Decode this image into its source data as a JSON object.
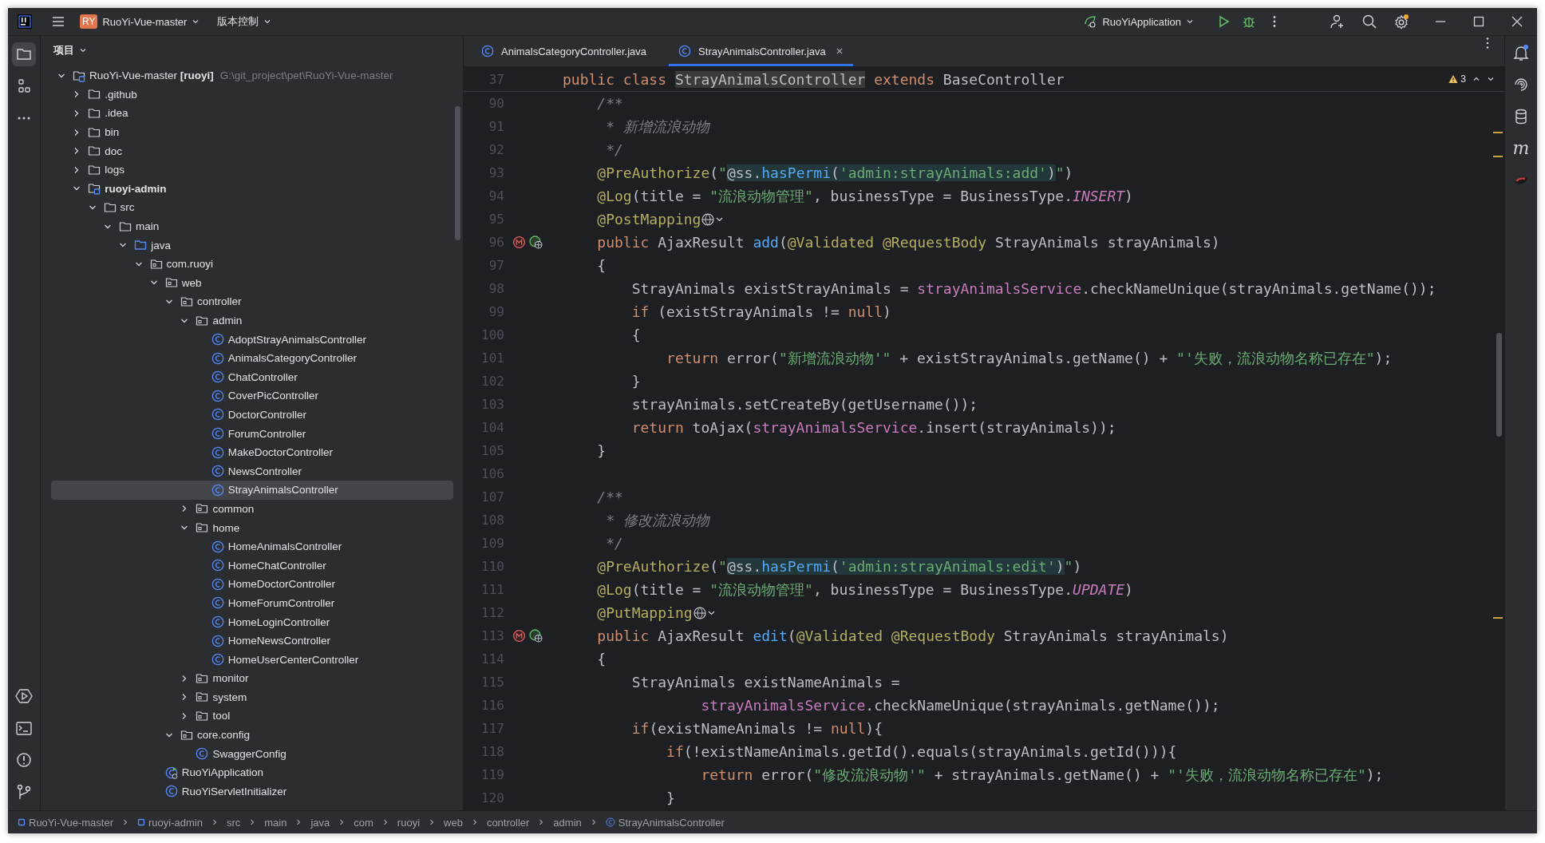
{
  "titlebar": {
    "project_badge": "RY",
    "project": "RuoYi-Vue-master",
    "vcs": "版本控制",
    "run_config": "RuoYiApplication"
  },
  "project": {
    "title": "项目",
    "tree": [
      {
        "label": "RuoYi-Vue-master **[ruoyi]**",
        "hint": "G:\\git_project\\pet\\RuoYi-Vue-master",
        "kind": "module",
        "expanded": true,
        "selected": false,
        "children": [
          {
            "label": ".github",
            "kind": "folder",
            "expanded": false,
            "selected": false
          },
          {
            "label": ".idea",
            "kind": "folder",
            "expanded": false,
            "selected": false
          },
          {
            "label": "bin",
            "kind": "folder",
            "expanded": false,
            "selected": false
          },
          {
            "label": "doc",
            "kind": "folder",
            "expanded": false,
            "selected": false
          },
          {
            "label": "logs",
            "kind": "folder",
            "expanded": false,
            "selected": false
          },
          {
            "label": "ruoyi-admin",
            "kind": "module",
            "bold": true,
            "expanded": true,
            "selected": false,
            "children": [
              {
                "label": "src",
                "kind": "folder",
                "expanded": true,
                "selected": false,
                "children": [
                  {
                    "label": "main",
                    "kind": "folder",
                    "expanded": true,
                    "selected": false,
                    "children": [
                      {
                        "label": "java",
                        "kind": "source",
                        "expanded": true,
                        "selected": false,
                        "children": [
                          {
                            "label": "com.ruoyi",
                            "kind": "package",
                            "expanded": true,
                            "selected": false,
                            "children": [
                              {
                                "label": "web",
                                "kind": "package",
                                "expanded": true,
                                "selected": false,
                                "children": [
                                  {
                                    "label": "controller",
                                    "kind": "package",
                                    "expanded": true,
                                    "selected": false,
                                    "children": [
                                      {
                                        "label": "admin",
                                        "kind": "package",
                                        "expanded": true,
                                        "selected": false,
                                        "children": [
                                          {
                                            "label": "AdoptStrayAnimalsController",
                                            "kind": "class",
                                            "selected": false
                                          },
                                          {
                                            "label": "AnimalsCategoryController",
                                            "kind": "class",
                                            "selected": false
                                          },
                                          {
                                            "label": "ChatController",
                                            "kind": "class",
                                            "selected": false
                                          },
                                          {
                                            "label": "CoverPicController",
                                            "kind": "class",
                                            "selected": false
                                          },
                                          {
                                            "label": "DoctorController",
                                            "kind": "class",
                                            "selected": false
                                          },
                                          {
                                            "label": "ForumController",
                                            "kind": "class",
                                            "selected": false
                                          },
                                          {
                                            "label": "MakeDoctorController",
                                            "kind": "class",
                                            "selected": false
                                          },
                                          {
                                            "label": "NewsController",
                                            "kind": "class",
                                            "selected": false
                                          },
                                          {
                                            "label": "StrayAnimalsController",
                                            "kind": "class",
                                            "selected": true
                                          }
                                        ]
                                      },
                                      {
                                        "label": "common",
                                        "kind": "package",
                                        "expanded": false,
                                        "selected": false
                                      },
                                      {
                                        "label": "home",
                                        "kind": "package",
                                        "expanded": true,
                                        "selected": false,
                                        "children": [
                                          {
                                            "label": "HomeAnimalsController",
                                            "kind": "class",
                                            "selected": false
                                          },
                                          {
                                            "label": "HomeChatController",
                                            "kind": "class",
                                            "selected": false
                                          },
                                          {
                                            "label": "HomeDoctorController",
                                            "kind": "class",
                                            "selected": false
                                          },
                                          {
                                            "label": "HomeForumController",
                                            "kind": "class",
                                            "selected": false
                                          },
                                          {
                                            "label": "HomeLoginController",
                                            "kind": "class",
                                            "selected": false
                                          },
                                          {
                                            "label": "HomeNewsController",
                                            "kind": "class",
                                            "selected": false
                                          },
                                          {
                                            "label": "HomeUserCenterController",
                                            "kind": "class",
                                            "selected": false
                                          }
                                        ]
                                      },
                                      {
                                        "label": "monitor",
                                        "kind": "package",
                                        "expanded": false,
                                        "selected": false
                                      },
                                      {
                                        "label": "system",
                                        "kind": "package",
                                        "expanded": false,
                                        "selected": false
                                      },
                                      {
                                        "label": "tool",
                                        "kind": "package",
                                        "expanded": false,
                                        "selected": false
                                      }
                                    ]
                                  },
                                  {
                                    "label": "core.config",
                                    "kind": "package",
                                    "expanded": true,
                                    "selected": false,
                                    "children": [
                                      {
                                        "label": "SwaggerConfig",
                                        "kind": "class",
                                        "selected": false
                                      }
                                    ]
                                  }
                                ]
                              },
                              {
                                "label": "RuoYiApplication",
                                "kind": "app",
                                "selected": false
                              },
                              {
                                "label": "RuoYiServletInitializer",
                                "kind": "class",
                                "selected": false
                              }
                            ]
                          }
                        ]
                      }
                    ]
                  }
                ]
              }
            ]
          }
        ]
      }
    ]
  },
  "editor": {
    "tabs": [
      {
        "label": "AnimalsCategoryController.java",
        "selected": false
      },
      {
        "label": "StrayAnimalsController.java",
        "selected": true
      }
    ],
    "warnings": "3",
    "sticky": {
      "number": "37",
      "tokens": [
        {
          "kind": "keyword",
          "text": "public class "
        },
        {
          "kind": "ref",
          "text": "StrayAnimalsController"
        },
        {
          "kind": "keyword",
          "text": " extends"
        },
        {
          "kind": "plain",
          "text": " BaseController"
        }
      ]
    },
    "lines": [
      {
        "number": "90",
        "tokens": [
          {
            "kind": "comment",
            "text": "    /**"
          }
        ]
      },
      {
        "number": "91",
        "tokens": [
          {
            "kind": "comment",
            "text": "     * 新增流浪动物"
          }
        ]
      },
      {
        "number": "92",
        "tokens": [
          {
            "kind": "comment",
            "text": "     */"
          }
        ]
      },
      {
        "number": "93",
        "tokens": [
          {
            "kind": "annotation",
            "text": "    @PreAuthorize"
          },
          {
            "kind": "plain",
            "text": "("
          },
          {
            "kind": "string",
            "text": "\""
          },
          {
            "kind": "inj-plain",
            "text": "@ss."
          },
          {
            "kind": "inj-method",
            "text": "hasPermi"
          },
          {
            "kind": "inj-plain",
            "text": "("
          },
          {
            "kind": "inj-string",
            "text": "'admin:strayAnimals:add'"
          },
          {
            "kind": "inj-plain",
            "text": ")"
          },
          {
            "kind": "string",
            "text": "\""
          },
          {
            "kind": "plain",
            "text": ")"
          }
        ]
      },
      {
        "number": "94",
        "tokens": [
          {
            "kind": "annotation",
            "text": "    @Log"
          },
          {
            "kind": "plain",
            "text": "(title = "
          },
          {
            "kind": "string",
            "text": "\"流浪动物管理\""
          },
          {
            "kind": "plain",
            "text": ", businessType = BusinessType."
          },
          {
            "kind": "constant",
            "text": "INSERT"
          },
          {
            "kind": "plain",
            "text": ")"
          }
        ]
      },
      {
        "number": "95",
        "endpoint": true,
        "tokens": [
          {
            "kind": "annotation",
            "text": "    @PostMapping"
          }
        ]
      },
      {
        "number": "96",
        "gutter": true,
        "tokens": [
          {
            "kind": "keyword",
            "text": "    public"
          },
          {
            "kind": "plain",
            "text": " AjaxResult "
          },
          {
            "kind": "decl",
            "text": "add"
          },
          {
            "kind": "plain",
            "text": "("
          },
          {
            "kind": "annotation",
            "text": "@Validated"
          },
          {
            "kind": "annotation",
            "text": " @RequestBody"
          },
          {
            "kind": "plain",
            "text": " StrayAnimals strayAnimals)"
          }
        ]
      },
      {
        "number": "97",
        "tokens": [
          {
            "kind": "plain",
            "text": "    {"
          }
        ]
      },
      {
        "number": "98",
        "tokens": [
          {
            "kind": "plain",
            "text": "        StrayAnimals existStrayAnimals = "
          },
          {
            "kind": "field",
            "text": "strayAnimalsService"
          },
          {
            "kind": "plain",
            "text": ".checkNameUnique(strayAnimals.getName());"
          }
        ]
      },
      {
        "number": "99",
        "tokens": [
          {
            "kind": "keyword",
            "text": "        if"
          },
          {
            "kind": "plain",
            "text": " (existStrayAnimals != "
          },
          {
            "kind": "keyword",
            "text": "null"
          },
          {
            "kind": "plain",
            "text": ")"
          }
        ]
      },
      {
        "number": "100",
        "tokens": [
          {
            "kind": "plain",
            "text": "        {"
          }
        ]
      },
      {
        "number": "101",
        "tokens": [
          {
            "kind": "keyword",
            "text": "            return"
          },
          {
            "kind": "plain",
            "text": " error("
          },
          {
            "kind": "string",
            "text": "\"新增流浪动物'\""
          },
          {
            "kind": "plain",
            "text": " + existStrayAnimals.getName() + "
          },
          {
            "kind": "string",
            "text": "\"'失败，流浪动物名称已存在\""
          },
          {
            "kind": "plain",
            "text": ");"
          }
        ]
      },
      {
        "number": "102",
        "tokens": [
          {
            "kind": "plain",
            "text": "        }"
          }
        ]
      },
      {
        "number": "103",
        "tokens": [
          {
            "kind": "plain",
            "text": "        strayAnimals.setCreateBy(getUsername());"
          }
        ]
      },
      {
        "number": "104",
        "tokens": [
          {
            "kind": "keyword",
            "text": "        return"
          },
          {
            "kind": "plain",
            "text": " toAjax("
          },
          {
            "kind": "field",
            "text": "strayAnimalsService"
          },
          {
            "kind": "plain",
            "text": ".insert(strayAnimals));"
          }
        ]
      },
      {
        "number": "105",
        "tokens": [
          {
            "kind": "plain",
            "text": "    }"
          }
        ]
      },
      {
        "number": "106"
      },
      {
        "number": "107",
        "tokens": [
          {
            "kind": "comment",
            "text": "    /**"
          }
        ]
      },
      {
        "number": "108",
        "tokens": [
          {
            "kind": "comment",
            "text": "     * 修改流浪动物"
          }
        ]
      },
      {
        "number": "109",
        "tokens": [
          {
            "kind": "comment",
            "text": "     */"
          }
        ]
      },
      {
        "number": "110",
        "tokens": [
          {
            "kind": "annotation",
            "text": "    @PreAuthorize"
          },
          {
            "kind": "plain",
            "text": "("
          },
          {
            "kind": "string",
            "text": "\""
          },
          {
            "kind": "inj-plain",
            "text": "@ss."
          },
          {
            "kind": "inj-method",
            "text": "hasPermi"
          },
          {
            "kind": "inj-plain",
            "text": "("
          },
          {
            "kind": "inj-string",
            "text": "'admin:strayAnimals:edit'"
          },
          {
            "kind": "inj-plain",
            "text": ")"
          },
          {
            "kind": "string",
            "text": "\""
          },
          {
            "kind": "plain",
            "text": ")"
          }
        ]
      },
      {
        "number": "111",
        "tokens": [
          {
            "kind": "annotation",
            "text": "    @Log"
          },
          {
            "kind": "plain",
            "text": "(title = "
          },
          {
            "kind": "string",
            "text": "\"流浪动物管理\""
          },
          {
            "kind": "plain",
            "text": ", businessType = BusinessType."
          },
          {
            "kind": "constant",
            "text": "UPDATE"
          },
          {
            "kind": "plain",
            "text": ")"
          }
        ]
      },
      {
        "number": "112",
        "endpoint": true,
        "tokens": [
          {
            "kind": "annotation",
            "text": "    @PutMapping"
          }
        ]
      },
      {
        "number": "113",
        "gutter": true,
        "tokens": [
          {
            "kind": "keyword",
            "text": "    public"
          },
          {
            "kind": "plain",
            "text": " AjaxResult "
          },
          {
            "kind": "decl",
            "text": "edit"
          },
          {
            "kind": "plain",
            "text": "("
          },
          {
            "kind": "annotation",
            "text": "@Validated"
          },
          {
            "kind": "annotation",
            "text": " @RequestBody"
          },
          {
            "kind": "plain",
            "text": " StrayAnimals strayAnimals)"
          }
        ]
      },
      {
        "number": "114",
        "tokens": [
          {
            "kind": "plain",
            "text": "    {"
          }
        ]
      },
      {
        "number": "115",
        "tokens": [
          {
            "kind": "plain",
            "text": "        StrayAnimals existNameAnimals ="
          }
        ]
      },
      {
        "number": "116",
        "tokens": [
          {
            "kind": "field",
            "text": "                strayAnimalsService"
          },
          {
            "kind": "plain",
            "text": ".checkNameUnique(strayAnimals.getName());"
          }
        ]
      },
      {
        "number": "117",
        "tokens": [
          {
            "kind": "keyword",
            "text": "        if"
          },
          {
            "kind": "plain",
            "text": "(existNameAnimals != "
          },
          {
            "kind": "keyword",
            "text": "null"
          },
          {
            "kind": "plain",
            "text": "){"
          }
        ]
      },
      {
        "number": "118",
        "tokens": [
          {
            "kind": "keyword",
            "text": "            if"
          },
          {
            "kind": "plain",
            "text": "(!existNameAnimals.getId().equals(strayAnimals.getId())){"
          }
        ]
      },
      {
        "number": "119",
        "tokens": [
          {
            "kind": "keyword",
            "text": "                return"
          },
          {
            "kind": "plain",
            "text": " error("
          },
          {
            "kind": "string",
            "text": "\"修改流浪动物'\""
          },
          {
            "kind": "plain",
            "text": " + strayAnimals.getName() + "
          },
          {
            "kind": "string",
            "text": "\"'失败，流浪动物名称已存在\""
          },
          {
            "kind": "plain",
            "text": ");"
          }
        ]
      },
      {
        "number": "120",
        "tokens": [
          {
            "kind": "plain",
            "text": "            }"
          }
        ]
      }
    ]
  },
  "right_toolbar": {
    "maven_label": "m"
  },
  "breadcrumbs": [
    {
      "label": "RuoYi-Vue-master",
      "kind": "module"
    },
    {
      "label": "ruoyi-admin",
      "kind": "module"
    },
    {
      "label": "src",
      "kind": "plain"
    },
    {
      "label": "main",
      "kind": "plain"
    },
    {
      "label": "java",
      "kind": "plain"
    },
    {
      "label": "com",
      "kind": "plain"
    },
    {
      "label": "ruoyi",
      "kind": "plain"
    },
    {
      "label": "web",
      "kind": "plain"
    },
    {
      "label": "controller",
      "kind": "plain"
    },
    {
      "label": "admin",
      "kind": "plain"
    },
    {
      "label": "StrayAnimalsController",
      "kind": "class"
    }
  ]
}
